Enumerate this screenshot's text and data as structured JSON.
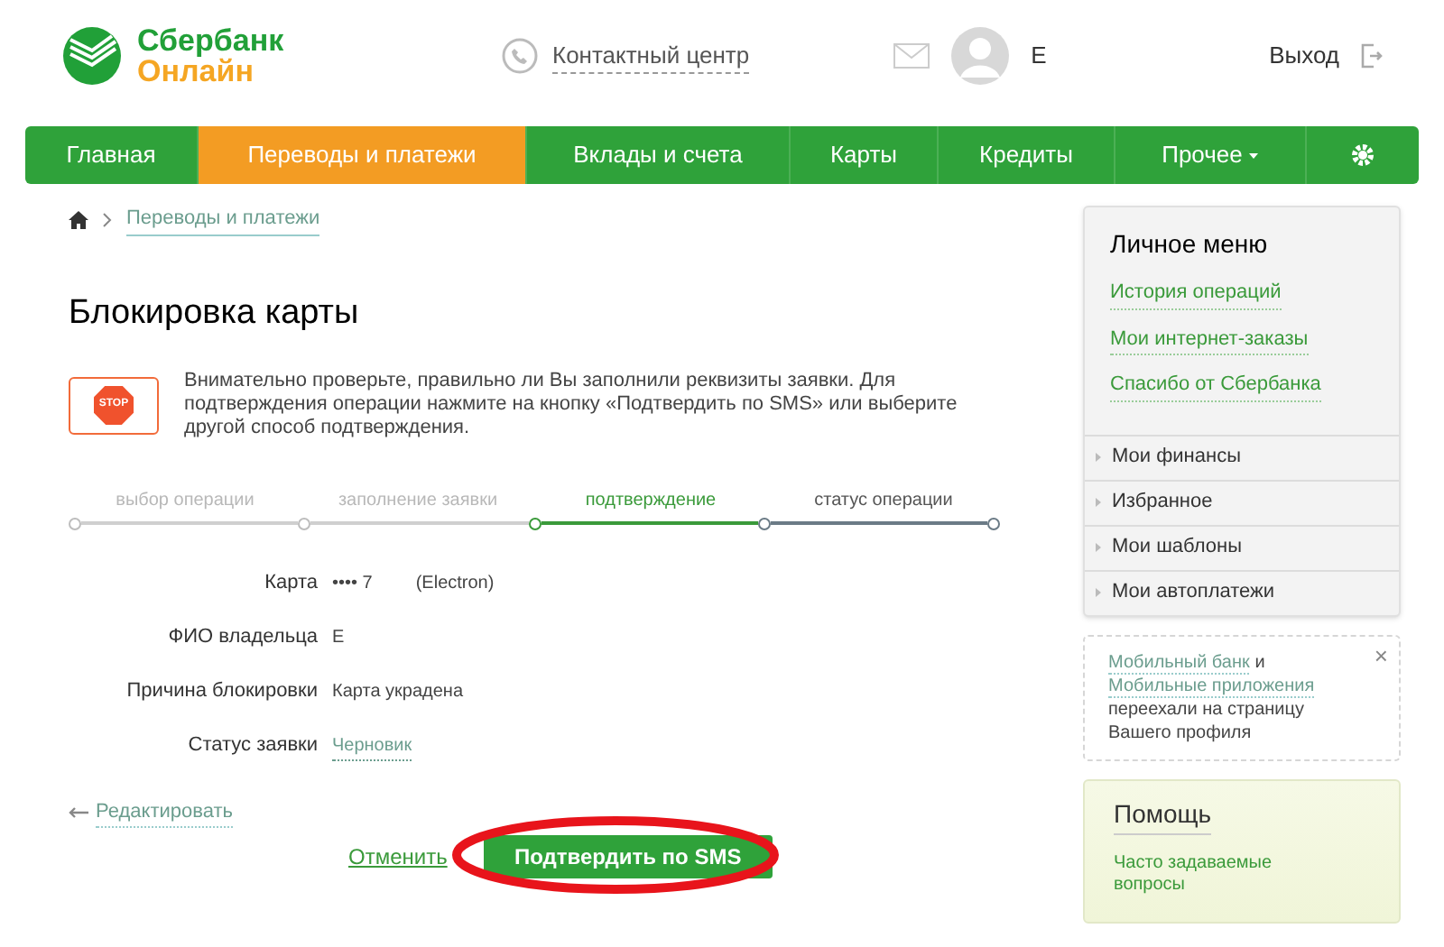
{
  "header": {
    "logo_line1": "Сбербанк",
    "logo_line2": "Онлайн",
    "contact": "Контактный центр",
    "user_name": "Е",
    "logout": "Выход"
  },
  "nav": [
    {
      "label": "Главная",
      "selected": false
    },
    {
      "label": "Переводы и платежи",
      "selected": true
    },
    {
      "label": "Вклады и счета",
      "selected": false
    },
    {
      "label": "Карты",
      "selected": false
    },
    {
      "label": "Кредиты",
      "selected": false
    },
    {
      "label": "Прочее",
      "selected": false,
      "dropdown": true
    }
  ],
  "breadcrumb": "Переводы и платежи",
  "title": "Блокировка карты",
  "notice": {
    "icon_text": "STOP",
    "text": "Внимательно проверьте, правильно ли Вы заполнили реквизиты заявки. Для подтверждения операции нажмите на кнопку «Подтвердить по SMS» или выберите другой способ подтверждения."
  },
  "steps": [
    {
      "label": "выбор операции",
      "done": true,
      "current": false
    },
    {
      "label": "заполнение заявки",
      "done": true,
      "current": false
    },
    {
      "label": "подтверждение",
      "done": false,
      "current": true
    },
    {
      "label": "статус операции",
      "done": false,
      "current": false
    }
  ],
  "fields": [
    {
      "label": "Карта",
      "value": "•••• 7",
      "note": "(Electron)",
      "kind": "text"
    },
    {
      "label": "ФИО владельца",
      "value": "Е",
      "kind": "text"
    },
    {
      "label": "Причина блокировки",
      "value": "Карта украдена",
      "kind": "text"
    },
    {
      "label": "Статус заявки",
      "value": "Черновик",
      "kind": "link"
    }
  ],
  "edit_link": "Редактировать",
  "cancel": "Отменить",
  "confirm": "Подтвердить по SMS",
  "personal_menu": {
    "title": "Личное меню",
    "links": [
      "История операций",
      "Мои интернет-заказы",
      "Спасибо от Сбербанка"
    ],
    "sections": [
      "Мои финансы",
      "Избранное",
      "Мои шаблоны",
      "Мои автоплатежи"
    ]
  },
  "tip": {
    "parts": [
      {
        "kind": "link",
        "text": "Мобильный банк"
      },
      {
        "kind": "text",
        "text": "и"
      },
      {
        "kind": "link",
        "text": "Мобильные приложения"
      },
      {
        "kind": "text",
        "text": "переехали на страницу Вашего профиля"
      }
    ],
    "close": "×"
  },
  "help": {
    "title": "Помощь",
    "link": "Часто задаваемые вопросы"
  }
}
